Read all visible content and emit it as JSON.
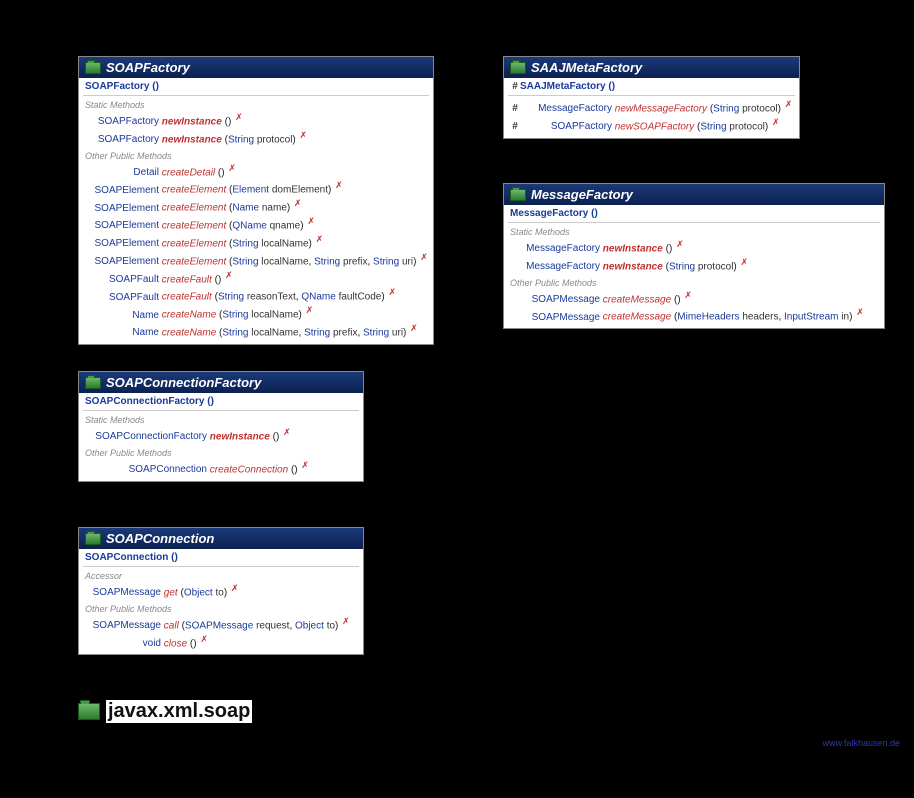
{
  "package": "javax.xml.soap",
  "watermark": "www.falkhausen.de",
  "boxes": {
    "soapFactory": {
      "title": "SOAPFactory",
      "constructor": "SOAPFactory ()",
      "staticLabel": "Static Methods",
      "otherLabel": "Other Public Methods",
      "statics": [
        {
          "ret": "SOAPFactory",
          "name": "newInstance",
          "params": [],
          "bold": true
        },
        {
          "ret": "SOAPFactory",
          "name": "newInstance",
          "params": [
            [
              "String",
              "protocol"
            ]
          ],
          "bold": true
        }
      ],
      "others": [
        {
          "ret": "Detail",
          "name": "createDetail",
          "params": []
        },
        {
          "ret": "SOAPElement",
          "name": "createElement",
          "params": [
            [
              "Element",
              "domElement"
            ]
          ]
        },
        {
          "ret": "SOAPElement",
          "name": "createElement",
          "params": [
            [
              "Name",
              "name"
            ]
          ]
        },
        {
          "ret": "SOAPElement",
          "name": "createElement",
          "params": [
            [
              "QName",
              "qname"
            ]
          ]
        },
        {
          "ret": "SOAPElement",
          "name": "createElement",
          "params": [
            [
              "String",
              "localName"
            ]
          ]
        },
        {
          "ret": "SOAPElement",
          "name": "createElement",
          "params": [
            [
              "String",
              "localName"
            ],
            [
              "String",
              "prefix"
            ],
            [
              "String",
              "uri"
            ]
          ]
        },
        {
          "ret": "SOAPFault",
          "name": "createFault",
          "params": []
        },
        {
          "ret": "SOAPFault",
          "name": "createFault",
          "params": [
            [
              "String",
              "reasonText"
            ],
            [
              "QName",
              "faultCode"
            ]
          ]
        },
        {
          "ret": "Name",
          "name": "createName",
          "params": [
            [
              "String",
              "localName"
            ]
          ]
        },
        {
          "ret": "Name",
          "name": "createName",
          "params": [
            [
              "String",
              "localName"
            ],
            [
              "String",
              "prefix"
            ],
            [
              "String",
              "uri"
            ]
          ]
        }
      ]
    },
    "saajMeta": {
      "title": "SAAJMetaFactory",
      "constructorVis": "#",
      "constructor": "SAAJMetaFactory ()",
      "methods": [
        {
          "vis": "#",
          "ret": "MessageFactory",
          "name": "newMessageFactory",
          "params": [
            [
              "String",
              "protocol"
            ]
          ]
        },
        {
          "vis": "#",
          "ret": "SOAPFactory",
          "name": "newSOAPFactory",
          "params": [
            [
              "String",
              "protocol"
            ]
          ]
        }
      ]
    },
    "messageFactory": {
      "title": "MessageFactory",
      "constructor": "MessageFactory ()",
      "staticLabel": "Static Methods",
      "otherLabel": "Other Public Methods",
      "statics": [
        {
          "ret": "MessageFactory",
          "name": "newInstance",
          "params": [],
          "bold": true
        },
        {
          "ret": "MessageFactory",
          "name": "newInstance",
          "params": [
            [
              "String",
              "protocol"
            ]
          ],
          "bold": true
        }
      ],
      "others": [
        {
          "ret": "SOAPMessage",
          "name": "createMessage",
          "params": []
        },
        {
          "ret": "SOAPMessage",
          "name": "createMessage",
          "params": [
            [
              "MimeHeaders",
              "headers"
            ],
            [
              "InputStream",
              "in"
            ]
          ]
        }
      ]
    },
    "connFactory": {
      "title": "SOAPConnectionFactory",
      "constructor": "SOAPConnectionFactory ()",
      "staticLabel": "Static Methods",
      "otherLabel": "Other Public Methods",
      "statics": [
        {
          "ret": "SOAPConnectionFactory",
          "name": "newInstance",
          "params": [],
          "bold": true
        }
      ],
      "others": [
        {
          "ret": "SOAPConnection",
          "name": "createConnection",
          "params": []
        }
      ]
    },
    "connection": {
      "title": "SOAPConnection",
      "constructor": "SOAPConnection ()",
      "accessorLabel": "Accessor",
      "otherLabel": "Other Public Methods",
      "accessors": [
        {
          "ret": "SOAPMessage",
          "name": "get",
          "params": [
            [
              "Object",
              "to"
            ]
          ]
        }
      ],
      "others": [
        {
          "ret": "SOAPMessage",
          "name": "call",
          "params": [
            [
              "SOAPMessage",
              "request"
            ],
            [
              "Object",
              "to"
            ]
          ]
        },
        {
          "ret": "void",
          "name": "close",
          "params": []
        }
      ]
    }
  }
}
